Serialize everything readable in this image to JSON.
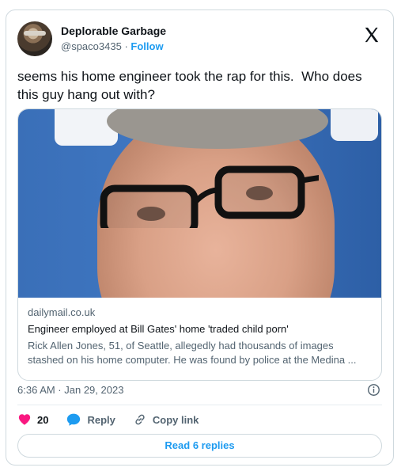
{
  "author": {
    "display_name": "Deplorable Garbage",
    "handle": "@spaco3435",
    "separator": "·",
    "follow_label": "Follow"
  },
  "tweet": {
    "text": "seems his home engineer took the rap for this.  Who does this guy hang out with?",
    "timestamp": "6:36 AM · Jan 29, 2023"
  },
  "link_card": {
    "domain": "dailymail.co.uk",
    "title": "Engineer employed at Bill Gates' home 'traded child porn'",
    "description": "Rick Allen Jones, 51, of Seattle, allegedly had thousands of images stashed on his home computer. He was found by police at the Medina ..."
  },
  "actions": {
    "like_count": "20",
    "reply_label": "Reply",
    "copy_link_label": "Copy link"
  },
  "read_replies_label": "Read 6 replies",
  "icons": {
    "brand": "x-logo-icon",
    "info": "info-icon",
    "like": "heart-icon",
    "reply": "speech-bubble-icon",
    "copy": "link-icon"
  },
  "colors": {
    "accent": "#1d9bf0",
    "like": "#f91880",
    "secondary_text": "#536471",
    "border": "#cfd9de"
  }
}
